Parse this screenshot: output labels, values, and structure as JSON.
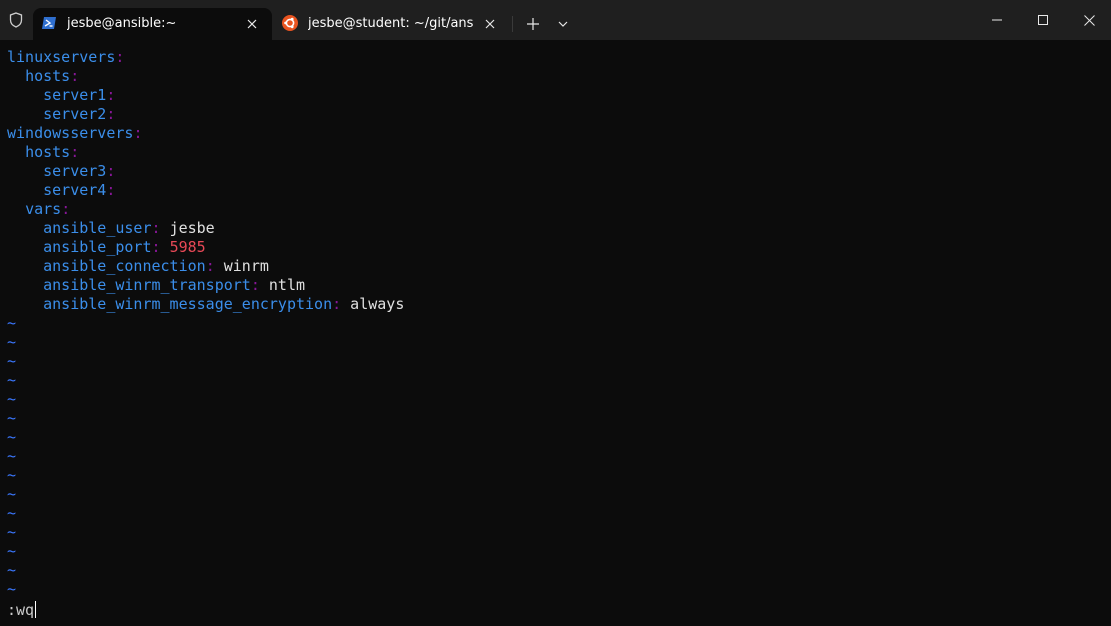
{
  "window": {
    "tabs": [
      {
        "title": "jesbe@ansible:~",
        "icon": "powershell-icon",
        "active": true
      },
      {
        "title": "jesbe@student: ~/git/ansiblec",
        "icon": "ubuntu-icon",
        "active": false
      }
    ],
    "controls": [
      "new-tab",
      "tab-dropdown",
      "minimize",
      "maximize",
      "close"
    ]
  },
  "colors": {
    "key": "#3b8eea",
    "colon": "#881798",
    "number": "#e74856",
    "tilde": "#3b78ff",
    "background": "#0c0c0c"
  },
  "editor": {
    "lines": [
      {
        "indent": "",
        "key": "linuxservers",
        "colon": ":",
        "value": "",
        "value_type": ""
      },
      {
        "indent": "  ",
        "key": "hosts",
        "colon": ":",
        "value": "",
        "value_type": ""
      },
      {
        "indent": "    ",
        "key": "server1",
        "colon": ":",
        "value": "",
        "value_type": ""
      },
      {
        "indent": "    ",
        "key": "server2",
        "colon": ":",
        "value": "",
        "value_type": ""
      },
      {
        "indent": "",
        "key": "windowsservers",
        "colon": ":",
        "value": "",
        "value_type": ""
      },
      {
        "indent": "  ",
        "key": "hosts",
        "colon": ":",
        "value": "",
        "value_type": ""
      },
      {
        "indent": "    ",
        "key": "server3",
        "colon": ":",
        "value": "",
        "value_type": ""
      },
      {
        "indent": "    ",
        "key": "server4",
        "colon": ":",
        "value": "",
        "value_type": ""
      },
      {
        "indent": "  ",
        "key": "vars",
        "colon": ":",
        "value": "",
        "value_type": ""
      },
      {
        "indent": "    ",
        "key": "ansible_user",
        "colon": ":",
        "value": "jesbe",
        "value_type": "str"
      },
      {
        "indent": "    ",
        "key": "ansible_port",
        "colon": ":",
        "value": "5985",
        "value_type": "num"
      },
      {
        "indent": "    ",
        "key": "ansible_connection",
        "colon": ":",
        "value": "winrm",
        "value_type": "str"
      },
      {
        "indent": "    ",
        "key": "ansible_winrm_transport",
        "colon": ":",
        "value": "ntlm",
        "value_type": "str"
      },
      {
        "indent": "    ",
        "key": "ansible_winrm_message_encryption",
        "colon": ":",
        "value": "always",
        "value_type": "str"
      }
    ],
    "empty_line_marker": "~",
    "empty_line_count": 15,
    "command_line": ":wq"
  }
}
